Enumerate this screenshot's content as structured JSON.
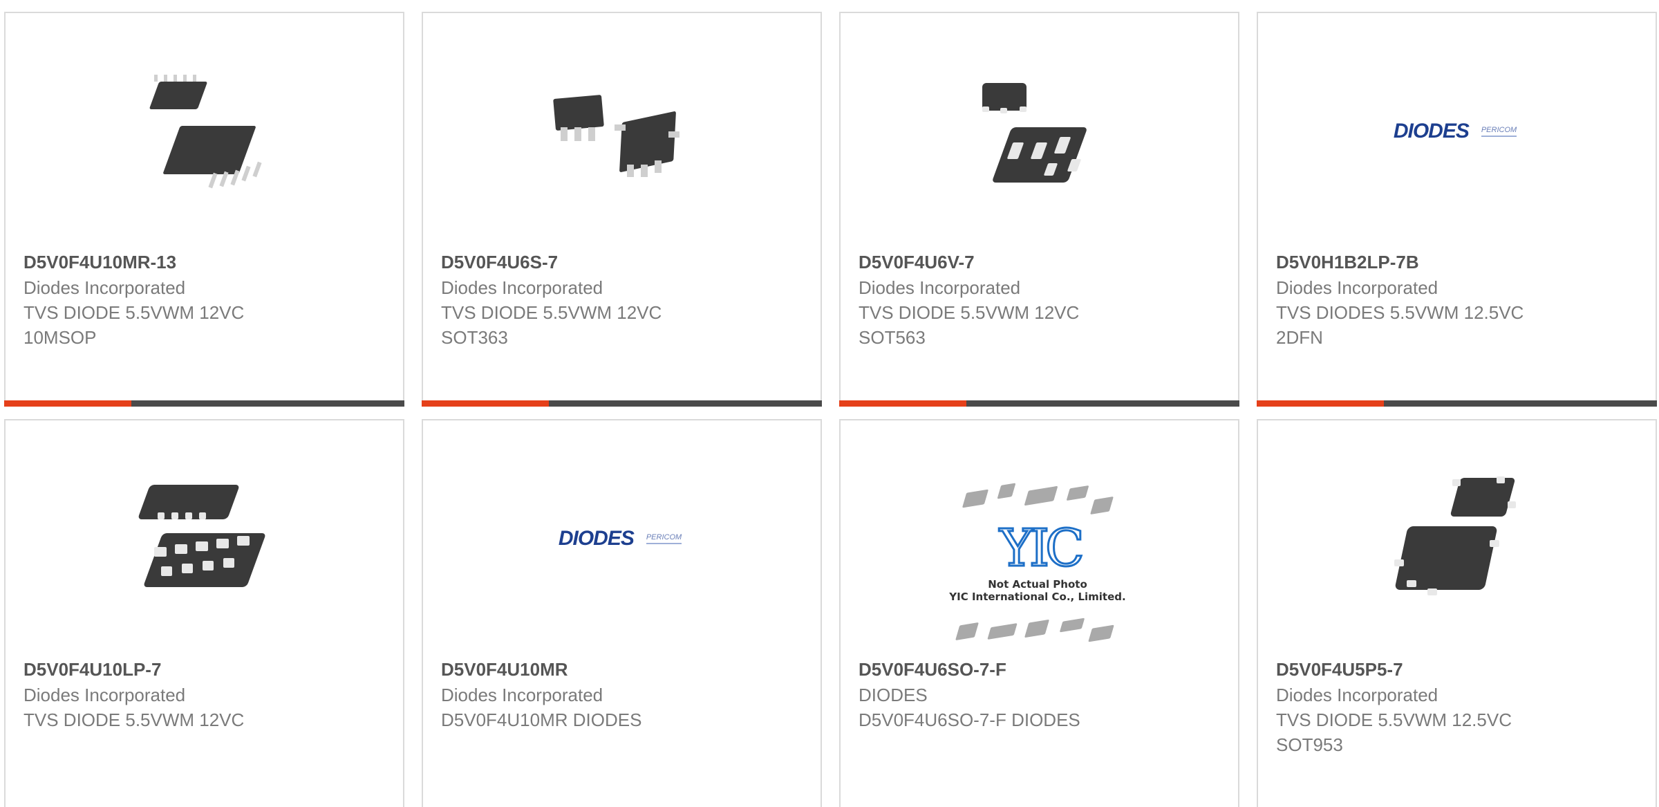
{
  "products": [
    {
      "part_number": "D5V0F4U10MR-13",
      "manufacturer": "Diodes Incorporated",
      "description": "TVS DIODE 5.5VWM 12VC\n10MSOP",
      "image": "msop-package-photo"
    },
    {
      "part_number": "D5V0F4U6S-7",
      "manufacturer": "Diodes Incorporated",
      "description": "TVS DIODE 5.5VWM 12VC\nSOT363",
      "image": "sot363-package-photo"
    },
    {
      "part_number": "D5V0F4U6V-7",
      "manufacturer": "Diodes Incorporated",
      "description": "TVS DIODE 5.5VWM 12VC\nSOT563",
      "image": "sot563-package-photo"
    },
    {
      "part_number": "D5V0H1B2LP-7B",
      "manufacturer": "Diodes Incorporated",
      "description": "TVS DIODES 5.5VWM 12.5VC\n2DFN",
      "image": "diodes-pericom-logo",
      "logo": {
        "brand": "DIODES",
        "sub": "PERICOM"
      }
    },
    {
      "part_number": "D5V0F4U10LP-7",
      "manufacturer": "Diodes Incorporated",
      "description": "TVS DIODE 5.5VWM 12VC",
      "image": "dfn-package-photo"
    },
    {
      "part_number": "D5V0F4U10MR",
      "manufacturer": "Diodes Incorporated",
      "description": "D5V0F4U10MR DIODES",
      "image": "diodes-pericom-logo",
      "logo": {
        "brand": "DIODES",
        "sub": "PERICOM"
      }
    },
    {
      "part_number": "D5V0F4U6SO-7-F",
      "manufacturer": "DIODES",
      "description": "D5V0F4U6SO-7-F DIODES",
      "image": "yic-placeholder-photo",
      "placeholder": {
        "mark": "YIC",
        "line1": "Not Actual Photo",
        "line2": "YIC International Co., Limited."
      }
    },
    {
      "part_number": "D5V0F4U5P5-7",
      "manufacturer": "Diodes Incorporated",
      "description": "TVS DIODE 5.5VWM 12.5VC\nSOT953",
      "image": "sot953-package-photo"
    }
  ],
  "colors": {
    "accent": "#e5401a",
    "bar": "#4a4a4a",
    "border": "#dadada"
  }
}
